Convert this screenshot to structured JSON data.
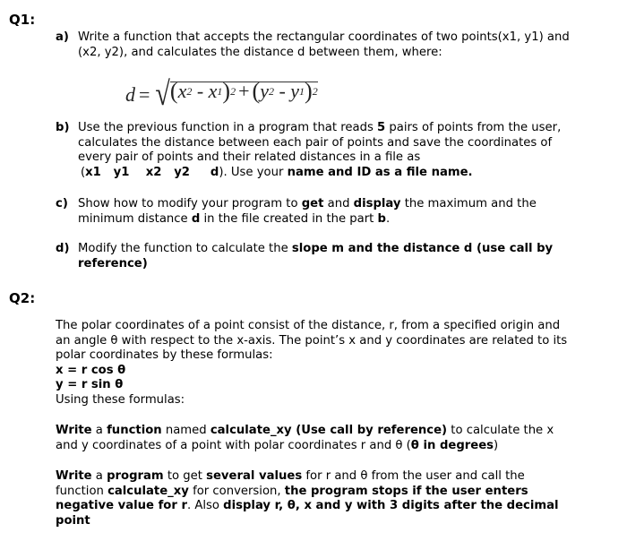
{
  "q1": {
    "title": "Q1:",
    "a": {
      "label": "a)",
      "line1": "Write a function that accepts the rectangular coordinates of two points(x1, y1) and",
      "line2": "(x2, y2), and calculates the distance d  between them, where:"
    },
    "formula": {
      "lhs": "d",
      "eq": "=",
      "x2": "x",
      "x2_sub": "2",
      "x1": "x",
      "x1_sub": "1",
      "y2": "y",
      "y2_sub": "2",
      "y1": "y",
      "y1_sub": "1",
      "exp": "2"
    },
    "b": {
      "label": "b)",
      "l1_pre": "Use the previous function in a program that reads ",
      "l1_bold": "5",
      "l1_post": " pairs of points from the user,",
      "line2": "calculates the distance between each pair of points and save the coordinates of",
      "line3": "every pair of points and their related distances in a file as",
      "l4_open": "(",
      "l4_bold_cols": "x1   y1    x2   y2     d",
      "l4_mid": "). Use your ",
      "l4_bold_end": "name and ID as a file name."
    },
    "c": {
      "label": "c)",
      "l1_pre": "Show how to modify your program to ",
      "l1_b1": "get",
      "l1_mid": " and ",
      "l1_b2": "display",
      "l1_post": " the maximum and the",
      "l2_pre": "minimum distance ",
      "l2_b1": "d",
      "l2_mid": " in the file created in the part ",
      "l2_b2": "b",
      "l2_post": "."
    },
    "d": {
      "label": "d)",
      "l1_pre": "Modify the function to calculate the ",
      "l1_bold": "slope m and the distance d (use call by",
      "l2_bold": "reference)"
    }
  },
  "q2": {
    "title": "Q2:",
    "intro": {
      "line1": "The polar coordinates of a point consist of the distance, r, from a specified origin and",
      "line2": "an angle θ with respect to the x-axis. The point’s x and y coordinates are related to its",
      "line3": "polar coordinates by these formulas:",
      "formula_x": "x = r cos θ",
      "formula_y": "y = r sin θ",
      "line6": "Using these formulas:"
    },
    "task1": {
      "b1": "Write",
      "t1": " a ",
      "b2": "function",
      "t2": " named ",
      "b3": "calculate_xy (Use call by reference)",
      "t3": " to calculate the x",
      "l2_pre": "and y coordinates of a point with polar coordinates r and θ (",
      "l2_bold": "θ in degrees",
      "l2_post": ")"
    },
    "task2": {
      "b1": "Write",
      "t1": " a ",
      "b2": "program",
      "t2": " to get ",
      "b3": "several values",
      "t3": " for r and θ from the user and call the",
      "l2_pre": "function ",
      "l2_b1": "calculate_xy",
      "l2_mid": " for conversion, ",
      "l2_b2": "the program stops if the user enters",
      "l3_b1": "negative value for r",
      "l3_mid": ". Also ",
      "l3_b2": "display r, θ, x and y with 3 digits after the decimal",
      "l4_bold": "point"
    }
  }
}
